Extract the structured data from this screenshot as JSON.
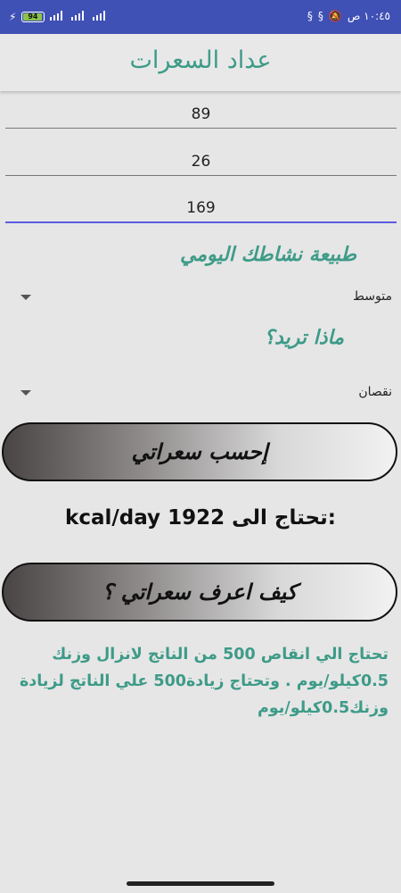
{
  "status": {
    "battery": "94",
    "time": "١٠:٤٥ ص"
  },
  "app": {
    "title": "عداد السعرات"
  },
  "inputs": [
    {
      "value": "89"
    },
    {
      "value": "26"
    },
    {
      "value": "169"
    }
  ],
  "activity": {
    "heading": "طبيعة نشاطك اليومي",
    "selected": "متوسط"
  },
  "goal": {
    "heading": "ماذا تريد؟",
    "selected": "نقصان"
  },
  "calculate_button": "إحسب سعراتي",
  "result": {
    "label": "تحتاج الى:",
    "value": "1922",
    "unit": "kcal/day"
  },
  "how_button": "كيف اعرف سعراتي ؟",
  "info": {
    "text": "تحتاج الي انقاص 500 من الناتج لانزال وزنك 0.5كيلو/يوم . وتحتاج زيادة500 علي الناتج لزيادة وزنك0.5كيلو/يوم"
  },
  "colors": {
    "status_bar": "#3f51b5",
    "accent": "#3d9b88",
    "focus_line": "#5c5be0"
  }
}
